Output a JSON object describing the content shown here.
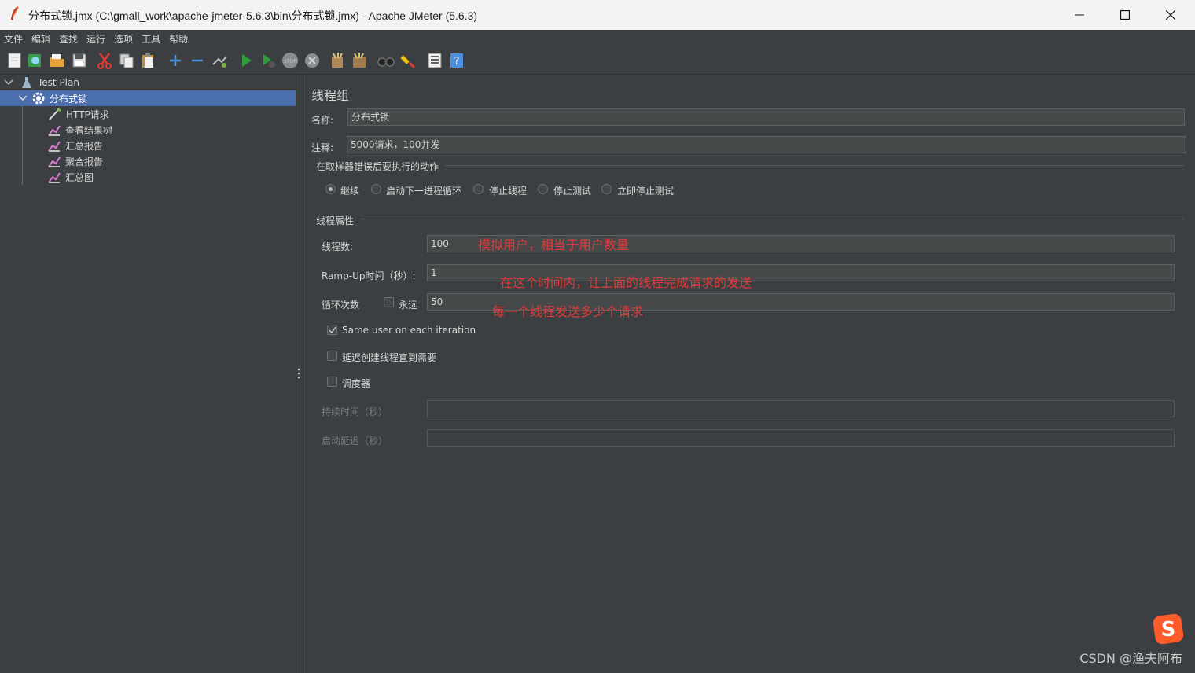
{
  "window": {
    "title": "分布式锁.jmx (C:\\gmall_work\\apache-jmeter-5.6.3\\bin\\分布式锁.jmx) - Apache JMeter (5.6.3)"
  },
  "menu": [
    "文件",
    "编辑",
    "查找",
    "运行",
    "选项",
    "工具",
    "帮助"
  ],
  "tree": {
    "root": "Test Plan",
    "group": "分布式锁",
    "children": [
      "HTTP请求",
      "查看结果树",
      "汇总报告",
      "聚合报告",
      "汇总图"
    ]
  },
  "panel": {
    "heading": "线程组",
    "name_label": "名称:",
    "name_value": "分布式锁",
    "comment_label": "注释:",
    "comment_value": "5000请求，100并发",
    "error_section": "在取样器错误后要执行的动作",
    "error_options": [
      "继续",
      "启动下一进程循环",
      "停止线程",
      "停止测试",
      "立即停止测试"
    ],
    "error_selected": "继续",
    "thread_section": "线程属性",
    "threads_label": "线程数:",
    "threads_value": "100",
    "rampup_label": "Ramp-Up时间（秒）:",
    "rampup_value": "1",
    "loop_label": "循环次数",
    "forever_label": "永远",
    "loop_value": "50",
    "same_user_label": "Same user on each iteration",
    "same_user_checked": true,
    "delay_label": "延迟创建线程直到需要",
    "scheduler_label": "调度器",
    "duration_label": "持续时间（秒）",
    "startup_delay_label": "启动延迟（秒）"
  },
  "annotations": {
    "threads_note": "模拟用户，相当于用户数量",
    "rampup_note": "在这个时间内，让上面的线程完成请求的发送",
    "loop_note": "每一个线程发送多少个请求"
  },
  "watermark": "CSDN @渔夫阿布",
  "colors": {
    "background": "#3c3f41",
    "selection": "#4b6eaf",
    "annotation": "#e23a3a"
  }
}
